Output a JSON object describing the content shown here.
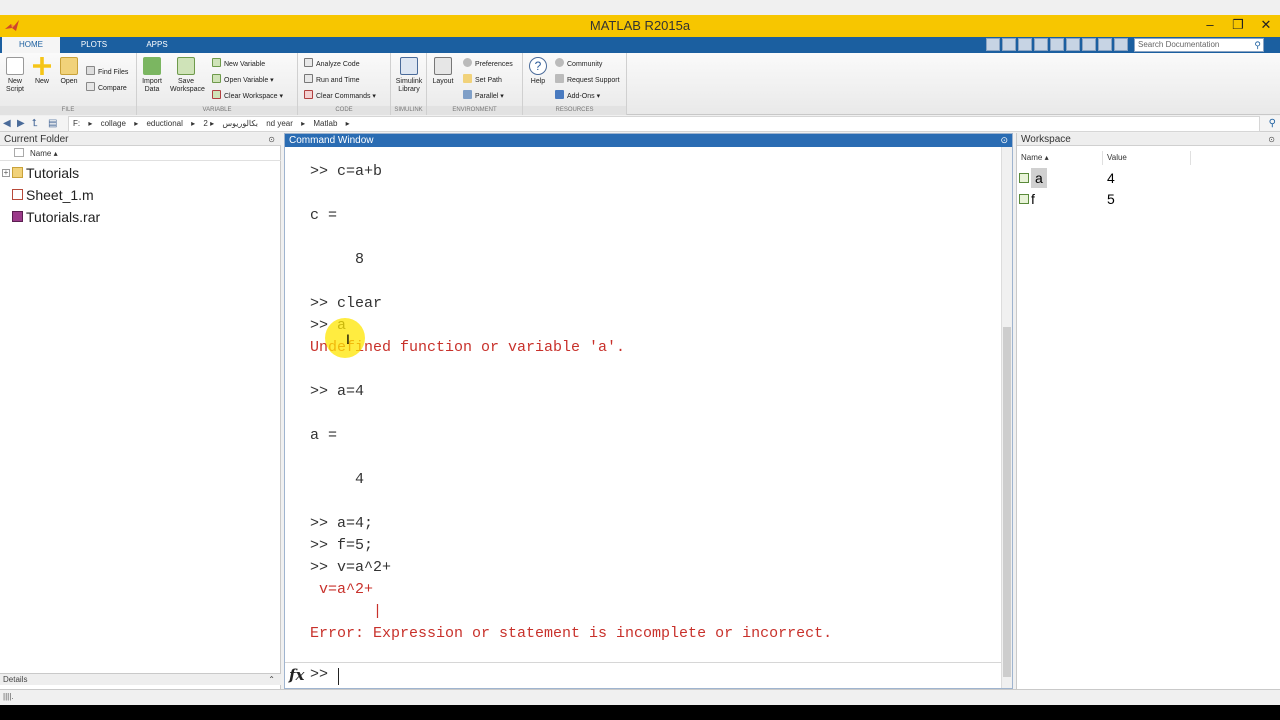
{
  "window": {
    "title": "MATLAB R2015a",
    "controls": [
      "–",
      "❐",
      "✕"
    ]
  },
  "tabs": [
    "HOME",
    "PLOTS",
    "APPS"
  ],
  "search": {
    "placeholder": "Search Documentation"
  },
  "ribbon": {
    "file": {
      "group_label": "FILE",
      "new_script": "New Script",
      "new": "New",
      "open": "Open",
      "find_files": "Find Files",
      "compare": "Compare"
    },
    "variable": {
      "group_label": "VARIABLE",
      "import_data": "Import Data",
      "save_workspace": "Save Workspace",
      "new_variable": "New Variable",
      "open_variable": "Open Variable",
      "clear_workspace": "Clear Workspace"
    },
    "code": {
      "group_label": "CODE",
      "analyze_code": "Analyze Code",
      "run_and_time": "Run and Time",
      "clear_commands": "Clear Commands"
    },
    "simulink": {
      "group_label": "SIMULINK",
      "simulink_library": "Simulink Library"
    },
    "environment": {
      "group_label": "ENVIRONMENT",
      "layout": "Layout",
      "preferences": "Preferences",
      "set_path": "Set Path",
      "parallel": "Parallel"
    },
    "resources": {
      "group_label": "RESOURCES",
      "help": "Help",
      "community": "Community",
      "request_support": "Request Support",
      "add_ons": "Add-Ons"
    }
  },
  "breadcrumbs": [
    "F:",
    "▸",
    "collage",
    "▸",
    "eductional",
    "▸",
    "بكالوريوس",
    "▸",
    "2 nd year",
    "▸",
    "Matlab",
    "▸"
  ],
  "current_folder": {
    "title": "Current Folder",
    "column_name": "Name ▴",
    "items": [
      {
        "name": "Tutorials",
        "kind": "folder"
      },
      {
        "name": "Sheet_1.m",
        "kind": "script"
      },
      {
        "name": "Tutorials.rar",
        "kind": "archive"
      }
    ],
    "details_label": "Details"
  },
  "command_window": {
    "title": "Command Window",
    "lines": [
      {
        "text": ">> c=a+b",
        "type": "input"
      },
      {
        "text": "",
        "type": "output"
      },
      {
        "text": "c =",
        "type": "output"
      },
      {
        "text": "",
        "type": "output"
      },
      {
        "text": "     8",
        "type": "output"
      },
      {
        "text": "",
        "type": "output"
      },
      {
        "text": ">> clear",
        "type": "input"
      },
      {
        "text": ">> a",
        "type": "input"
      },
      {
        "text": "Undefined function or variable 'a'.",
        "type": "error"
      },
      {
        "text": "",
        "type": "output"
      },
      {
        "text": ">> a=4",
        "type": "input"
      },
      {
        "text": "",
        "type": "output"
      },
      {
        "text": "a =",
        "type": "output"
      },
      {
        "text": "",
        "type": "output"
      },
      {
        "text": "     4",
        "type": "output"
      },
      {
        "text": "",
        "type": "output"
      },
      {
        "text": ">> a=4;",
        "type": "input"
      },
      {
        "text": ">> f=5;",
        "type": "input"
      },
      {
        "text": ">> v=a^2+",
        "type": "input"
      },
      {
        "text": " v=a^2+",
        "type": "error"
      },
      {
        "text": "       |",
        "type": "error"
      },
      {
        "text": "Error: Expression or statement is incomplete or incorrect.",
        "type": "error"
      }
    ],
    "fx_label": "fx",
    "prompt": ">>"
  },
  "workspace": {
    "title": "Workspace",
    "col_name": "Name ▴",
    "col_value": "Value",
    "vars": [
      {
        "name": "a",
        "value": "4",
        "selected": true
      },
      {
        "name": "f",
        "value": "5",
        "selected": false
      }
    ]
  },
  "colors": {
    "title_bar": "#f7c600",
    "tab_bar": "#1b5fa0",
    "error_text": "#c8312b",
    "panel_title_active": "#2a6cb3"
  }
}
